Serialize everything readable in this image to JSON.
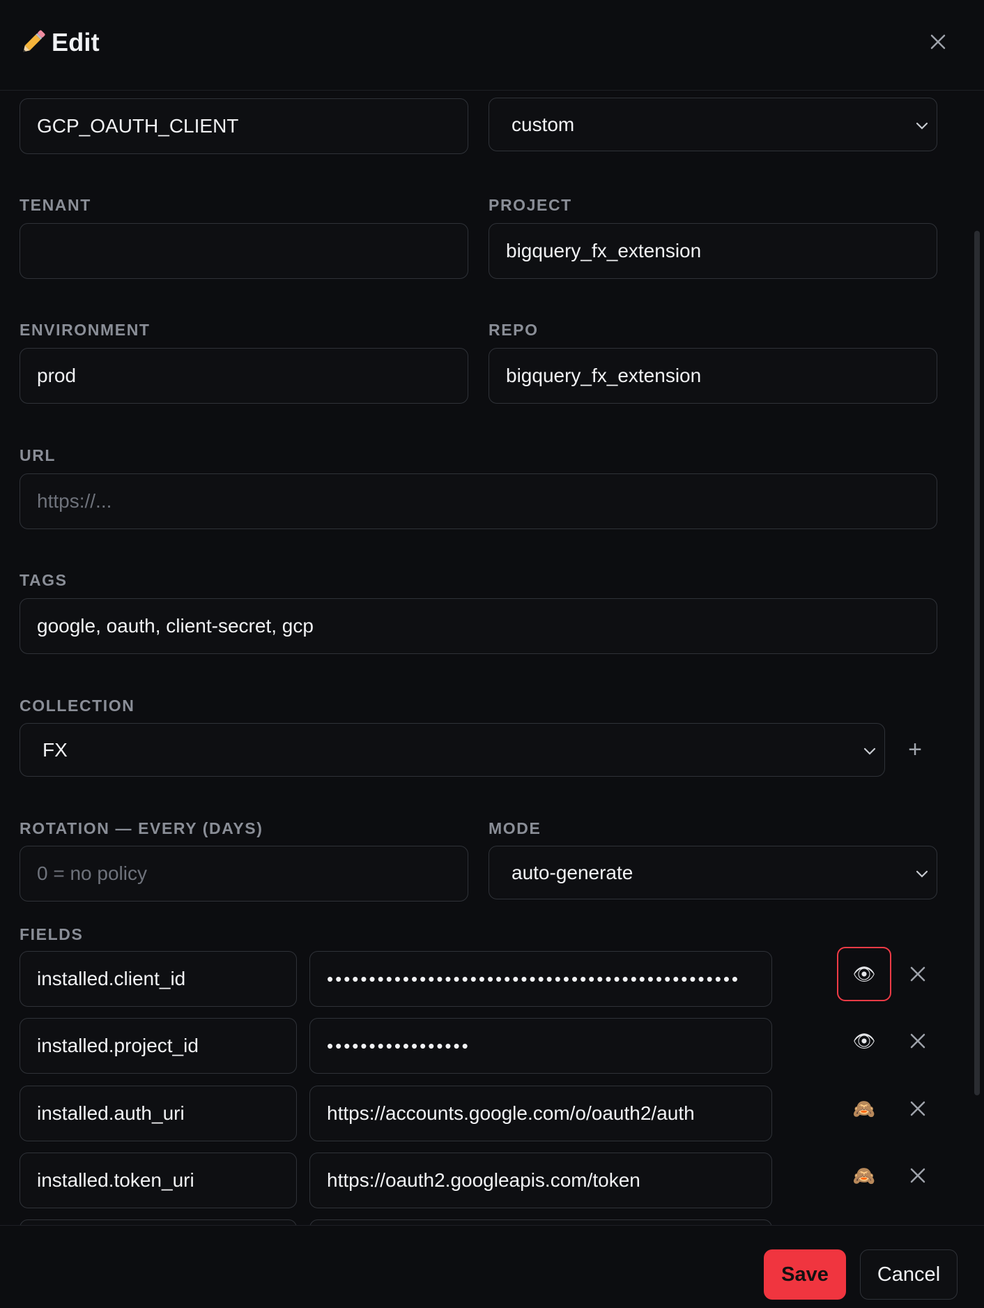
{
  "dialog": {
    "title": "Edit",
    "title_icon": "pencil-icon",
    "close_icon": "close-icon"
  },
  "form": {
    "name": {
      "value": "GCP_OAUTH_CLIENT"
    },
    "type": {
      "value": "custom"
    },
    "tenant": {
      "label": "TENANT",
      "value": ""
    },
    "project": {
      "label": "PROJECT",
      "value": "bigquery_fx_extension"
    },
    "environment": {
      "label": "ENVIRONMENT",
      "value": "prod"
    },
    "repo": {
      "label": "REPO",
      "value": "bigquery_fx_extension"
    },
    "url": {
      "label": "URL",
      "placeholder": "https://..."
    },
    "tags": {
      "label": "TAGS",
      "value": "google, oauth, client-secret, gcp"
    },
    "collection": {
      "label": "COLLECTION",
      "value": "FX",
      "add_label": "+"
    },
    "rotation": {
      "label": "ROTATION — EVERY (DAYS)",
      "placeholder": "0 = no policy"
    },
    "mode": {
      "label": "MODE",
      "value": "auto-generate"
    },
    "fields": {
      "label": "FIELDS",
      "rows": [
        {
          "key": "installed.client_id",
          "value": "•••••••••••••••••••••••••••••••••••••••••••••••••",
          "visibility_icon": "👁"
        },
        {
          "key": "installed.project_id",
          "value": "•••••••••••••••••",
          "visibility_icon": "👁"
        },
        {
          "key": "installed.auth_uri",
          "value": "https://accounts.google.com/o/oauth2/auth",
          "visibility_icon": "🙈"
        },
        {
          "key": "installed.token_uri",
          "value": "https://oauth2.googleapis.com/token",
          "visibility_icon": "🙈"
        }
      ]
    }
  },
  "footer": {
    "save_label": "Save",
    "cancel_label": "Cancel"
  },
  "colors": {
    "accent": "#f0353f",
    "background": "#0c0d10",
    "border": "#2f3238"
  }
}
